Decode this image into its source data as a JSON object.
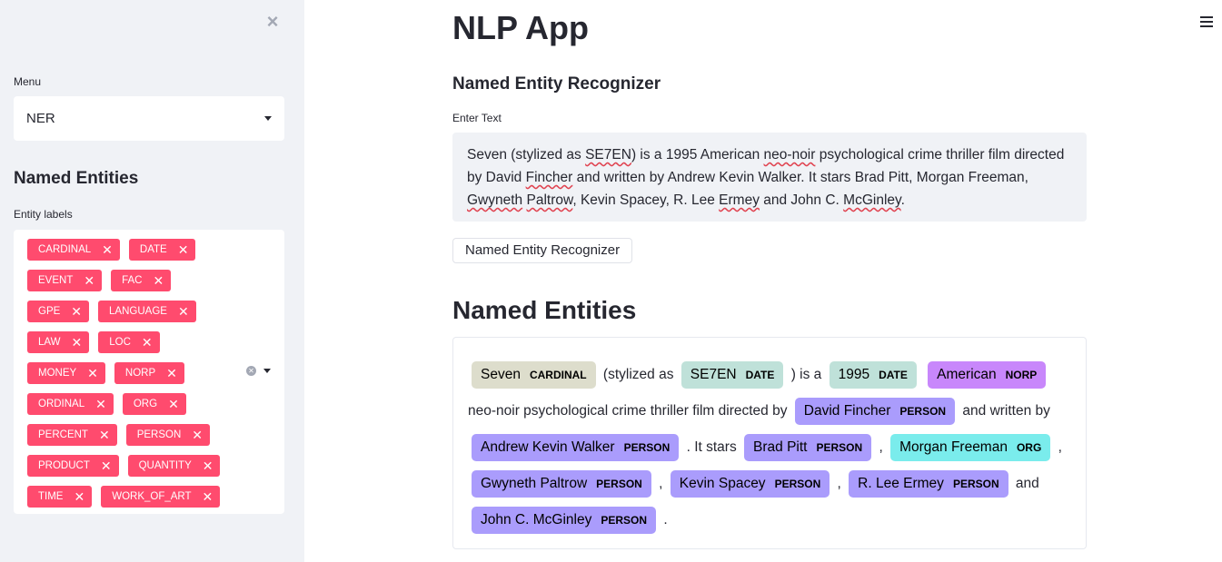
{
  "sidebar": {
    "close_icon": "close-icon",
    "menu_label": "Menu",
    "menu_value": "NER",
    "heading": "Named Entities",
    "entity_labels_title": "Entity labels",
    "tag_rows": [
      [
        "CARDINAL",
        "DATE"
      ],
      [
        "EVENT",
        "FAC"
      ],
      [
        "GPE",
        "LANGUAGE"
      ],
      [
        "LAW",
        "LOC"
      ],
      [
        "MONEY",
        "NORP"
      ],
      [
        "ORDINAL",
        "ORG"
      ],
      [
        "PERCENT",
        "PERSON"
      ],
      [
        "PRODUCT",
        "QUANTITY"
      ],
      [
        "TIME",
        "WORK_OF_ART"
      ]
    ],
    "tag_close": "✕",
    "clear_glyph": "✕"
  },
  "main": {
    "app_title": "NLP App",
    "subtitle": "Named Entity Recognizer",
    "text_label": "Enter Text",
    "input_segments": [
      {
        "t": "Seven (stylized as "
      },
      {
        "t": "SE7EN",
        "sq": true
      },
      {
        "t": ") is a 1995 American "
      },
      {
        "t": "neo-noir",
        "sq": true
      },
      {
        "t": " psychological crime thriller film directed by David "
      },
      {
        "t": "Fincher",
        "sq": true
      },
      {
        "t": " and written by Andrew Kevin Walker. It stars Brad Pitt, Morgan Freeman, "
      },
      {
        "t": "Gwyneth",
        "sq": true
      },
      {
        "t": " "
      },
      {
        "t": "Paltrow",
        "sq": true
      },
      {
        "t": ", Kevin Spacey, R. Lee "
      },
      {
        "t": "Ermey",
        "sq": true
      },
      {
        "t": " and John C. "
      },
      {
        "t": "McGinley",
        "sq": true
      },
      {
        "t": "."
      }
    ],
    "button_label": "Named Entity Recognizer",
    "results_title": "Named Entities"
  },
  "colors": {
    "tag": "#ff4b6e",
    "CARDINAL": "#ddddcc",
    "DATE": "#bfe1d9",
    "NORP": "#c887fb",
    "PERSON": "#aa9cfc",
    "ORG": "#7aecec"
  },
  "ner_segments": [
    {
      "e": "Seven",
      "l": "CARDINAL"
    },
    {
      "p": " (stylized as "
    },
    {
      "e": "SE7EN",
      "l": "DATE"
    },
    {
      "p": " ) is a "
    },
    {
      "e": "1995",
      "l": "DATE"
    },
    {
      "p": " "
    },
    {
      "e": "American",
      "l": "NORP"
    },
    {
      "p": " neo-noir psychological crime thriller film directed by "
    },
    {
      "e": "David Fincher",
      "l": "PERSON"
    },
    {
      "p": " and written by "
    },
    {
      "e": "Andrew Kevin Walker",
      "l": "PERSON"
    },
    {
      "p": " . It stars "
    },
    {
      "e": "Brad Pitt",
      "l": "PERSON"
    },
    {
      "p": " , "
    },
    {
      "e": "Morgan Freeman",
      "l": "ORG"
    },
    {
      "p": " , "
    },
    {
      "e": "Gwyneth Paltrow",
      "l": "PERSON"
    },
    {
      "p": " , "
    },
    {
      "e": "Kevin Spacey",
      "l": "PERSON"
    },
    {
      "p": " , "
    },
    {
      "e": "R. Lee Ermey",
      "l": "PERSON"
    },
    {
      "p": " and "
    },
    {
      "e": "John C. McGinley",
      "l": "PERSON"
    },
    {
      "p": " ."
    }
  ]
}
